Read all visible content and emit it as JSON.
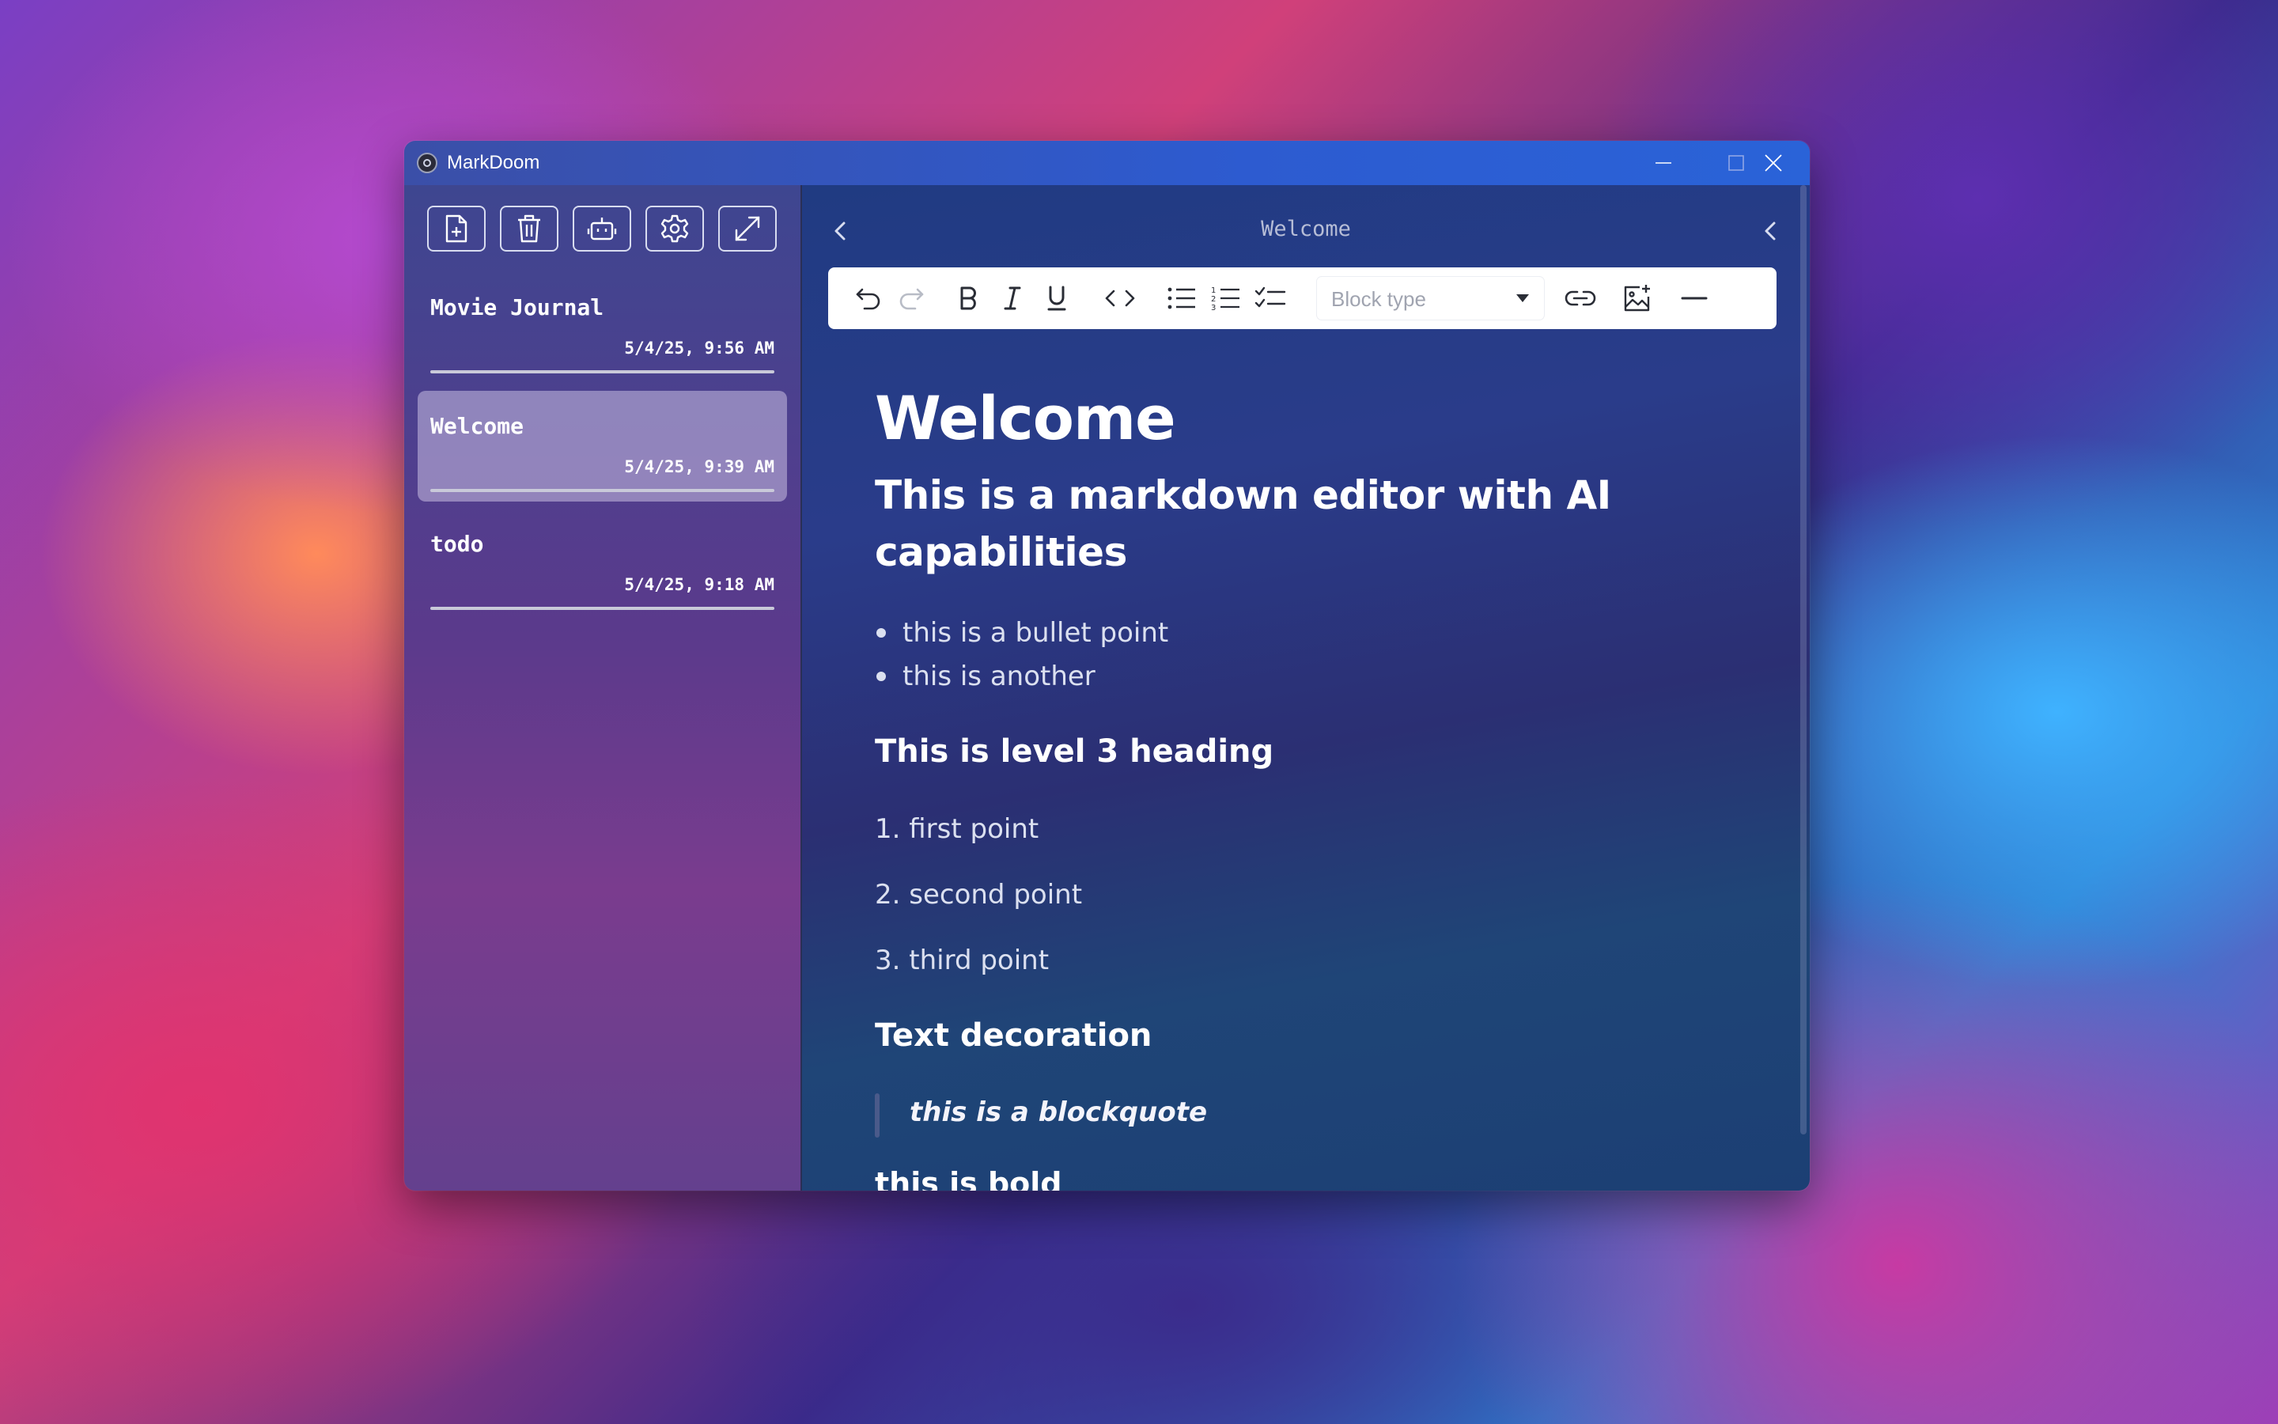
{
  "app": {
    "title": "MarkDoom"
  },
  "window_controls": [
    "minimize",
    "maximize",
    "close"
  ],
  "sidebar": {
    "toolbar": [
      {
        "icon": "new-note-icon",
        "action": "new"
      },
      {
        "icon": "trash-icon",
        "action": "delete"
      },
      {
        "icon": "robot-icon",
        "action": "ai"
      },
      {
        "icon": "gear-icon",
        "action": "settings"
      },
      {
        "icon": "expand-icon",
        "action": "fullscreen"
      }
    ],
    "notes": [
      {
        "title": "Movie Journal",
        "date": "5/4/25, 9:56 AM",
        "active": false
      },
      {
        "title": "Welcome",
        "date": "5/4/25, 9:39 AM",
        "active": true
      },
      {
        "title": "todo",
        "date": "5/4/25, 9:18 AM",
        "active": false
      }
    ]
  },
  "editor": {
    "header_title": "Welcome",
    "toolbar": {
      "block_type_placeholder": "Block type"
    },
    "content": {
      "h1": "Welcome",
      "h2": "This is a markdown editor with AI capabilities",
      "bullets": [
        "this is a bullet point",
        "this is another"
      ],
      "h3_a": "This is level 3 heading",
      "ordered": [
        "1. first point",
        "2. second point",
        "3. third point"
      ],
      "h3_b": "Text decoration",
      "blockquote": "this is a blockquote",
      "cut_off": "this is bold"
    }
  },
  "colors": {
    "titlebar": "#2d5bd0",
    "toolbar_bg": "#ffffff",
    "text": "#ffffff"
  }
}
